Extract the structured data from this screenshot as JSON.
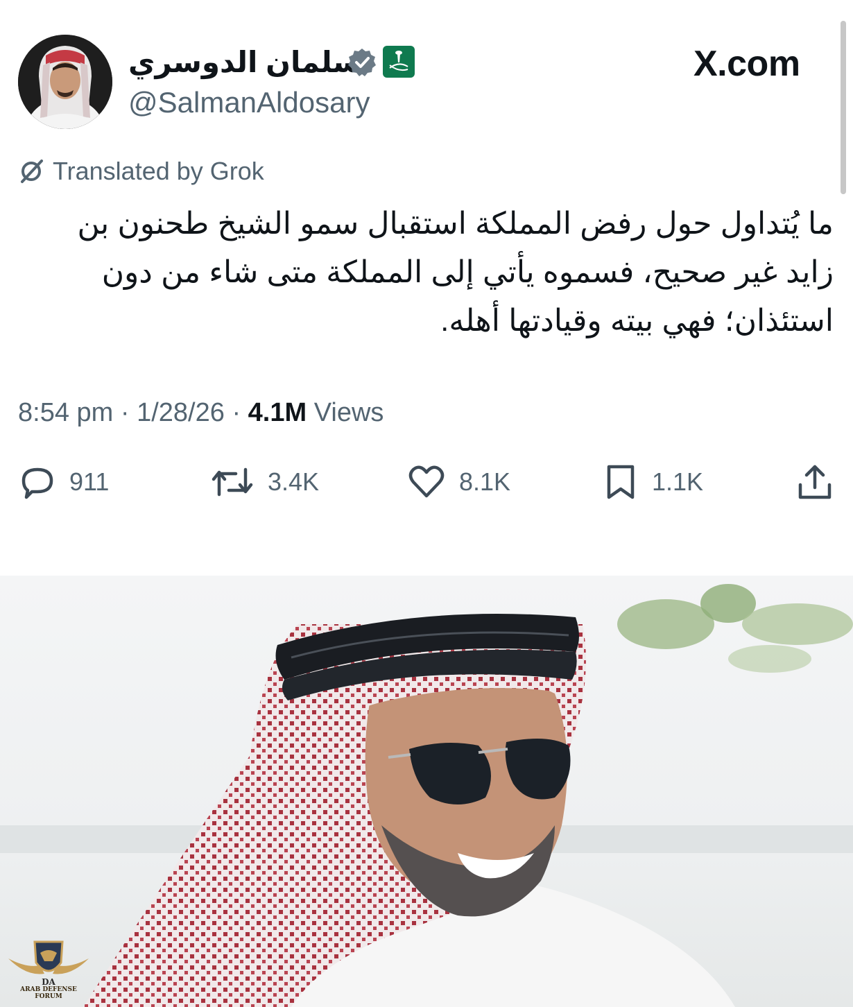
{
  "header": {
    "display_name": "سلمان الدوسري",
    "handle": "@SalmanAldosary",
    "site": "X.com",
    "verified_icon": "verified-badge-icon",
    "flag_icon": "saudi-emblem-icon"
  },
  "translation": {
    "label": "Translated by Grok",
    "icon": "grok-icon"
  },
  "tweet": {
    "text": "ما يُتداول حول رفض المملكة استقبال سمو الشيخ طحنون بن زايد غير صحيح، فسموه يأتي إلى المملكة متى شاء من دون استئذان؛ فهي بيته وقيادتها أهله."
  },
  "meta": {
    "time": "8:54 pm",
    "separator": "·",
    "date": "1/28/26",
    "views_count": "4.1M",
    "views_label": "Views"
  },
  "actions": {
    "replies": "911",
    "reposts": "3.4K",
    "likes": "8.1K",
    "bookmarks": "1.1K"
  },
  "watermark": {
    "logo_letters": "DA",
    "text": "ARAB DEFENSE FORUM"
  },
  "colors": {
    "text_primary": "#0f1419",
    "text_secondary": "#536471",
    "flag_green": "#0f7a4f",
    "verified_gray": "#6b7a86"
  }
}
